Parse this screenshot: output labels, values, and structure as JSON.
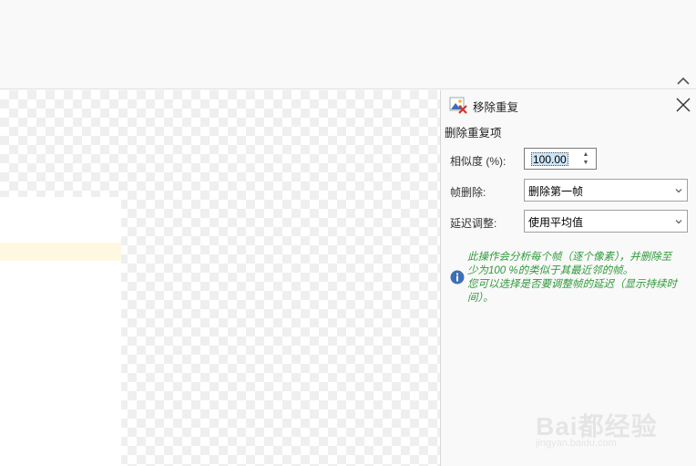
{
  "panel": {
    "title": "移除重复",
    "section_title": "删除重复项",
    "similarity": {
      "label": "相似度 (%):",
      "value": "100.00"
    },
    "frame_removal": {
      "label": "帧删除:",
      "selected": "删除第一帧"
    },
    "delay_adjust": {
      "label": "延迟调整:",
      "selected": "使用平均值"
    },
    "info": {
      "line1": "此操作会分析每个帧（逐个像素），并删除至",
      "line2": "少为100 %的类似于其最近邻的帧。",
      "line3": "您可以选择是否要调整帧的延迟（显示持续时",
      "line4": "间）。"
    }
  },
  "watermark": {
    "brand": "Bai都经验",
    "url": "jingyan.baidu.com"
  },
  "colors": {
    "info_text": "#2e9a3a",
    "info_icon": "#3d6fb4",
    "selection": "#cce4f7"
  },
  "icons": {
    "collapse": "chevron-up-icon",
    "close": "close-icon",
    "header": "image-remove-icon",
    "info": "info-icon",
    "dropdown": "chevron-down-icon"
  }
}
